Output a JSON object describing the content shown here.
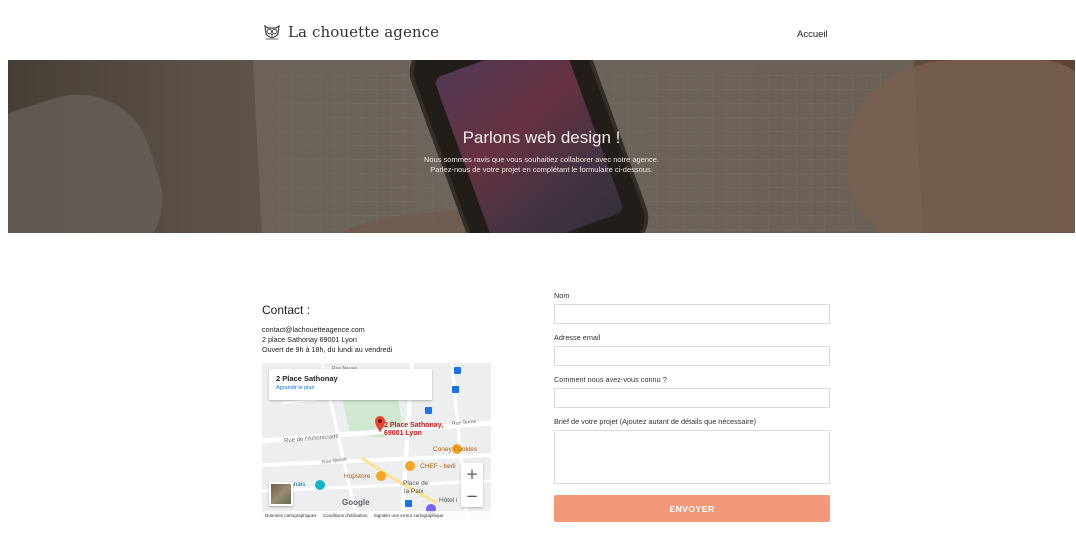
{
  "header": {
    "logo_text": "La chouette agence",
    "nav": [
      {
        "label": "Accueil"
      }
    ]
  },
  "hero": {
    "title": "Parlons web design !",
    "subtitle_line1": "Nous sommes ravis que vous souhaitiez collaborer avec notre agence.",
    "subtitle_line2": "Parlez-nous de votre projet en complétant le formulaire ci-dessous."
  },
  "contact": {
    "title": "Contact :",
    "email": "contact@lachouetteagence.com",
    "address": "2 place Sathonay 69001 Lyon",
    "hours": "Ouvert de 9h à 18h, du lundi au vendredi"
  },
  "map": {
    "card_title": "2 Place Sathonay",
    "card_link": "Agrandir le plan",
    "marker_line1": "2 Place Sathonay,",
    "marker_line2": "69001 Lyon",
    "pois": [
      "Coney Cookies",
      "CHEF - berli",
      "Hopstore",
      "Place de",
      "la Paix",
      "Hôtel i",
      "nnais"
    ],
    "streets": [
      "Rue de l'Arbre Sec",
      "Rue de l'Amoniciade",
      "Rue Terme",
      "Rue Neuve",
      "Rue Neuve"
    ],
    "brand": "Google",
    "footer": [
      "Données cartographiques",
      "Conditions d'utilisation",
      "Signaler une erreur cartographique"
    ],
    "zoom_in": "+",
    "zoom_out": "−",
    "colors": {
      "marker": "#ea4335",
      "poi": "#f5a623",
      "transit": "#1a73e8",
      "park": "#cfe8cf"
    }
  },
  "form": {
    "name_label": "Nom",
    "name_value": "",
    "email_label": "Adresse email",
    "email_value": "",
    "source_label": "Comment nous avez-vous connu ?",
    "source_value": "",
    "brief_label": "Brief de votre projet (Ajoutez autant de détails que nécessaire)",
    "brief_value": "",
    "submit_label": "ENVOYER",
    "submit_color": "#f3997a"
  }
}
